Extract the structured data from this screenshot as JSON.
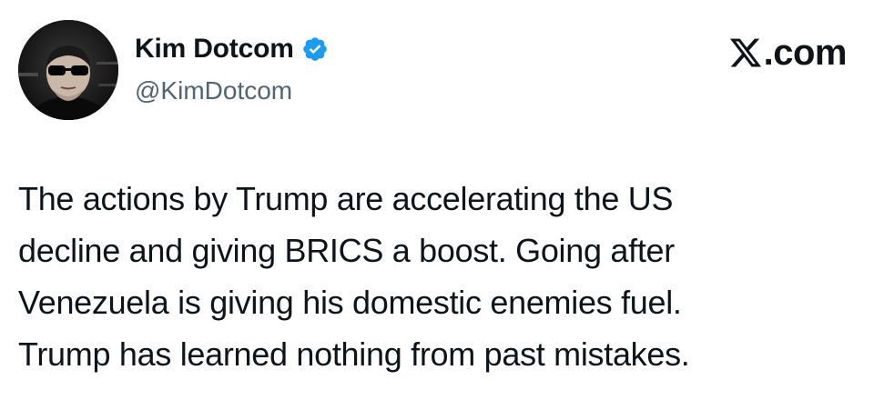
{
  "colors": {
    "text": "#0f1419",
    "secondary_text": "#536471",
    "verified_blue": "#1d9bf0",
    "background": "#ffffff"
  },
  "author": {
    "display_name": "Kim Dotcom",
    "handle": "@KimDotcom",
    "verified": true,
    "verified_icon": "verified-badge-icon",
    "avatar_icon": "profile-avatar"
  },
  "brand": {
    "logo_icon": "x-logo-icon",
    "suffix": ".com"
  },
  "tweet": {
    "lines": [
      "The actions by Trump are accelerating the US",
      "decline and giving BRICS a boost. Going after",
      "Venezuela is giving his domestic enemies fuel.",
      "Trump has learned nothing from past mistakes."
    ]
  }
}
